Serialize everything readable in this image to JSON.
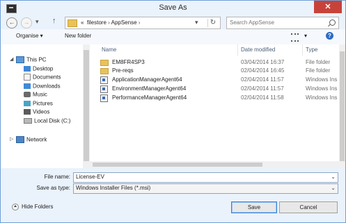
{
  "window": {
    "title": "Save As",
    "close_glyph": "✕"
  },
  "nav": {
    "back_glyph": "←",
    "forward_glyph": "→",
    "dropdown_glyph": "▾",
    "up_glyph": "↑",
    "path_prefix": "«",
    "path_segments": [
      "filestore",
      "AppSense"
    ],
    "path_separator": "›",
    "refresh_glyph": "↻",
    "search_placeholder": "Search AppSense"
  },
  "toolbar": {
    "organise_label": "Organise ▾",
    "new_folder_label": "New folder",
    "view_dropdown": "▾",
    "help_glyph": "?"
  },
  "sidebar": {
    "items": [
      {
        "label": "This PC",
        "icon": "computer-icon"
      },
      {
        "label": "Desktop",
        "icon": "desktop-icon"
      },
      {
        "label": "Documents",
        "icon": "documents-icon"
      },
      {
        "label": "Downloads",
        "icon": "downloads-icon"
      },
      {
        "label": "Music",
        "icon": "music-icon"
      },
      {
        "label": "Pictures",
        "icon": "pictures-icon"
      },
      {
        "label": "Videos",
        "icon": "videos-icon"
      },
      {
        "label": "Local Disk (C:)",
        "icon": "disk-icon"
      },
      {
        "label": "Network",
        "icon": "network-icon"
      }
    ]
  },
  "columns": {
    "name": "Name",
    "date": "Date modified",
    "type": "Type"
  },
  "files": [
    {
      "name": "EM8FR4SP3",
      "date": "03/04/2014 16:37",
      "type": "File folder",
      "icon": "folder-icon"
    },
    {
      "name": "Pre-reqs",
      "date": "02/04/2014 16:45",
      "type": "File folder",
      "icon": "folder-icon"
    },
    {
      "name": "ApplicationManagerAgent64",
      "date": "02/04/2014 11:57",
      "type": "Windows Ins",
      "icon": "msi-icon"
    },
    {
      "name": "EnvironmentManagerAgent64",
      "date": "02/04/2014 11:57",
      "type": "Windows Ins",
      "icon": "msi-icon"
    },
    {
      "name": "PerformanceManagerAgent64",
      "date": "02/04/2014 11:58",
      "type": "Windows Ins",
      "icon": "msi-icon"
    }
  ],
  "form": {
    "file_name_label": "File name:",
    "file_name_value": "License-EV",
    "save_type_label": "Save as type:",
    "save_type_value": "Windows Installer Files (*.msi)",
    "dropdown_glyph": "⌄"
  },
  "footer": {
    "hide_folders_label": "Hide Folders",
    "save_label": "Save",
    "cancel_label": "Cancel"
  }
}
